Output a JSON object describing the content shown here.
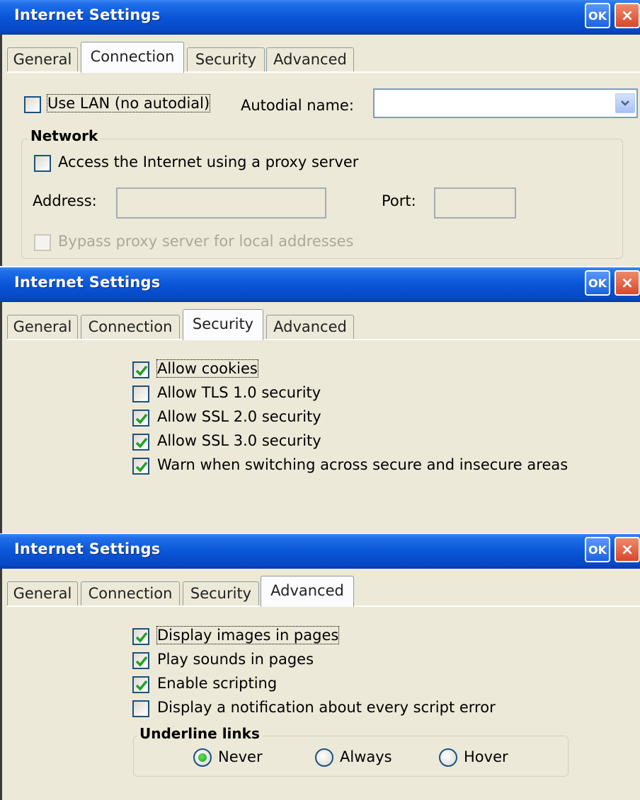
{
  "panels": [
    {
      "title": "Internet Settings",
      "ok_label": "OK",
      "close_label": "×",
      "tabs": [
        "General",
        "Connection",
        "Security",
        "Advanced"
      ],
      "active_tab": "Connection",
      "connection": {
        "use_lan_label": "Use LAN (no autodial)",
        "use_lan_checked": false,
        "autodial_label": "Autodial name:",
        "autodial_value": "",
        "network_group": "Network",
        "proxy_label": "Access the Internet using a proxy server",
        "proxy_checked": false,
        "address_label": "Address:",
        "address_value": "",
        "port_label": "Port:",
        "port_value": "",
        "bypass_label": "Bypass proxy server for local addresses",
        "bypass_checked": false
      }
    },
    {
      "title": "Internet Settings",
      "ok_label": "OK",
      "close_label": "×",
      "tabs": [
        "General",
        "Connection",
        "Security",
        "Advanced"
      ],
      "active_tab": "Security",
      "security": {
        "options": [
          {
            "label": "Allow cookies",
            "checked": true
          },
          {
            "label": "Allow TLS 1.0 security",
            "checked": false
          },
          {
            "label": "Allow SSL 2.0 security",
            "checked": true
          },
          {
            "label": "Allow SSL 3.0 security",
            "checked": true
          },
          {
            "label": "Warn when switching across secure and insecure areas",
            "checked": true
          }
        ]
      }
    },
    {
      "title": "Internet Settings",
      "ok_label": "OK",
      "close_label": "×",
      "tabs": [
        "General",
        "Connection",
        "Security",
        "Advanced"
      ],
      "active_tab": "Advanced",
      "advanced": {
        "options": [
          {
            "label": "Display images in pages",
            "checked": true
          },
          {
            "label": "Play sounds in pages",
            "checked": true
          },
          {
            "label": "Enable scripting",
            "checked": true
          },
          {
            "label": "Display a notification about every script error",
            "checked": false
          }
        ],
        "underline_group": "Underline links",
        "underline_options": [
          "Never",
          "Always",
          "Hover"
        ],
        "underline_selected": "Never"
      }
    }
  ],
  "colors": {
    "titlebar": "#0a55d8",
    "panel_bg": "#ece9d8",
    "check_green": "#21a121",
    "checkbox_border": "#1c5180"
  }
}
